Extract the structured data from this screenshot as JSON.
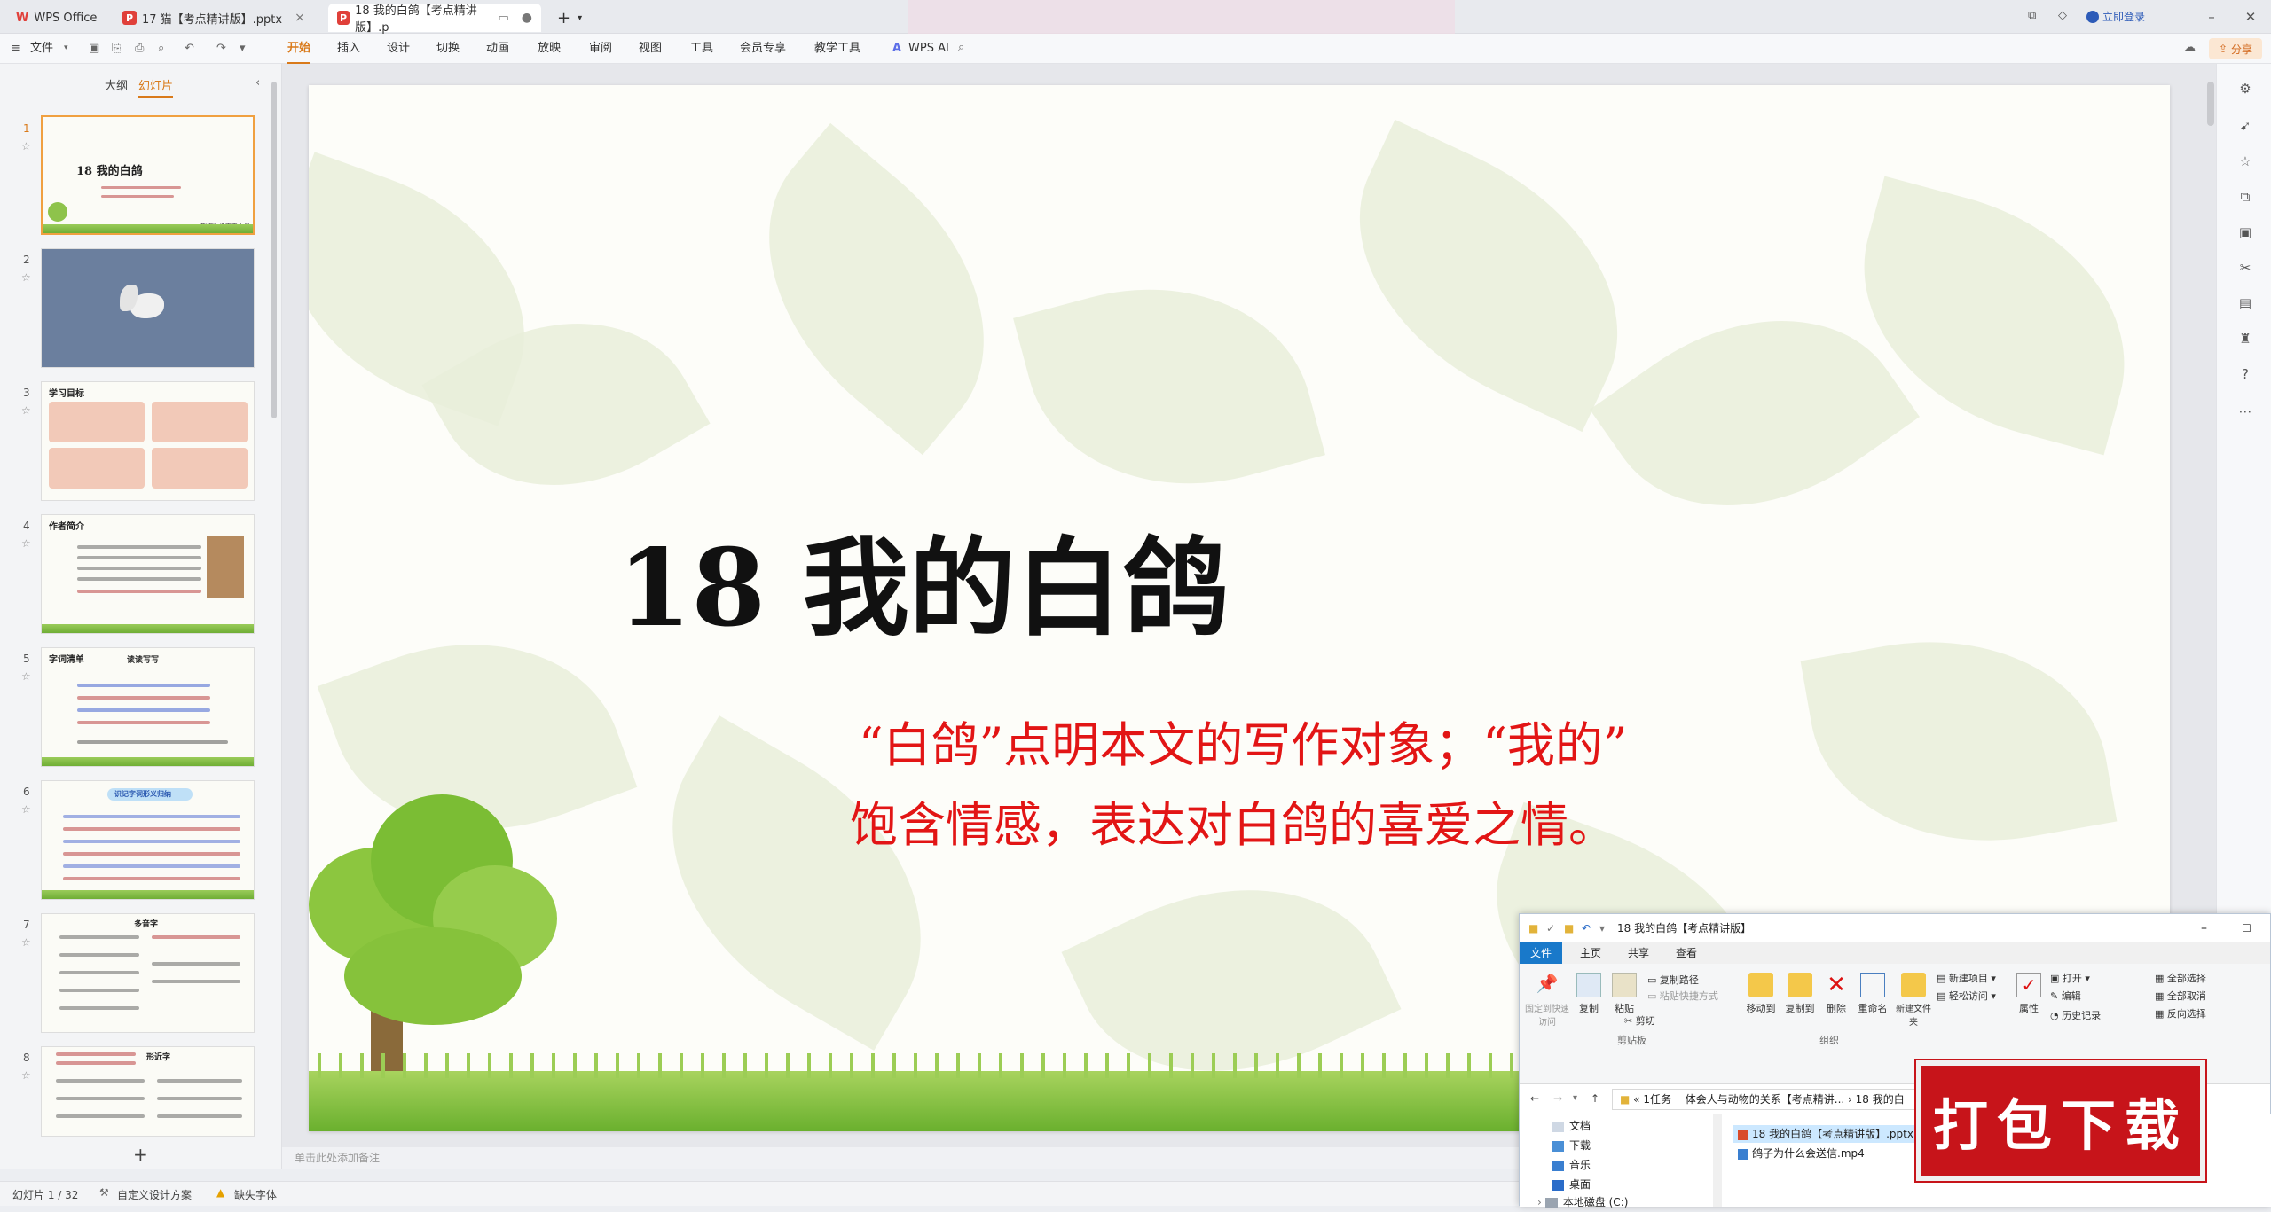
{
  "titlebar": {
    "app_name": "WPS Office",
    "tabs": [
      {
        "label": "17 猫【考点精讲版】.pptx"
      },
      {
        "label": "18 我的白鸽【考点精讲版】.p"
      }
    ],
    "login_label": "立即登录"
  },
  "menubar": {
    "file_label": "文件",
    "items": [
      "开始",
      "插入",
      "设计",
      "切换",
      "动画",
      "放映",
      "审阅",
      "视图",
      "工具",
      "会员专享",
      "教学工具"
    ],
    "wps_ai_label": "WPS AI",
    "share_label": "分享"
  },
  "left_panel": {
    "tabs": [
      "大纲",
      "幻灯片"
    ],
    "slides": [
      {
        "num": "1",
        "title": "18  我的白鸽",
        "caption": "部编版语文五上册"
      },
      {
        "num": "2",
        "title": ""
      },
      {
        "num": "3",
        "title": "学习目标"
      },
      {
        "num": "4",
        "title": "作者简介"
      },
      {
        "num": "5",
        "title": "字词清单",
        "subtitle": "读读写写"
      },
      {
        "num": "6",
        "title": "识记字词形义归纳"
      },
      {
        "num": "7",
        "title": "多音字"
      },
      {
        "num": "8",
        "title": "形近字"
      }
    ],
    "add_label": "+"
  },
  "slide": {
    "title": "18  我的白鸽",
    "sub_line1": "“白鸽”点明本文的写作对象；“我的”",
    "sub_line2": "饱含情感，表达对白鸽的喜爱之情。"
  },
  "notes_placeholder": "单击此处添加备注",
  "statusbar": {
    "slide_counter": "幻灯片 1 / 32",
    "design_label": "自定义设计方案",
    "font_label": "缺失字体"
  },
  "explorer": {
    "title": "18 我的白鸽【考点精讲版】",
    "tabs": [
      "文件",
      "主页",
      "共享",
      "查看"
    ],
    "ribbon": {
      "pin_label": "固定到快速访问",
      "copy_label": "复制",
      "paste_label": "粘贴",
      "copy_path_label": "复制路径",
      "paste_shortcut_label": "粘贴快捷方式",
      "cut_label": "剪切",
      "clipboard_group": "剪贴板",
      "move_to_label": "移动到",
      "copy_to_label": "复制到",
      "delete_label": "删除",
      "rename_label": "重命名",
      "new_folder_label": "新建文件夹",
      "new_item_label": "新建项目",
      "easy_access_label": "轻松访问",
      "organize_group": "组织",
      "properties_label": "属性",
      "open_label": "打开",
      "edit_label": "编辑",
      "history_label": "历史记录",
      "select_all_label": "全部选择",
      "select_none_label": "全部取消",
      "invert_label": "反向选择"
    },
    "address": "1任务一 体会人与动物的关系【考点精讲...  ›  18 我的白",
    "nav_items": [
      "文档",
      "下载",
      "音乐",
      "桌面",
      "本地磁盘 (C:)"
    ],
    "files": [
      "18 我的白鸽【考点精讲版】.pptx",
      "鸽子为什么会送信.mp4"
    ]
  },
  "download_badge": "打包下载"
}
